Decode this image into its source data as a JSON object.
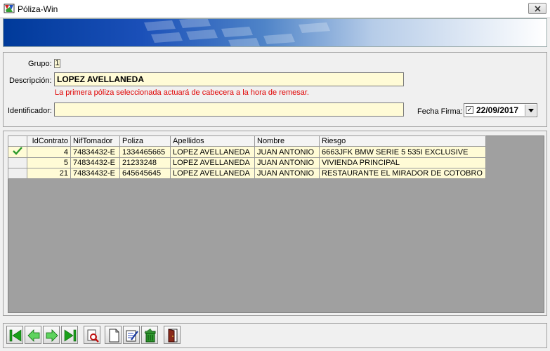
{
  "window": {
    "title": "Póliza-Win"
  },
  "form": {
    "grupo_label": "Grupo:",
    "grupo_value": "1",
    "descripcion_label": "Descripción:",
    "descripcion_value": "LOPEZ AVELLANEDA",
    "notice": "La primera póliza seleccionada actuará de cabecera a la hora de remesar.",
    "identificador_label": "Identificador:",
    "identificador_value": "",
    "fecha_firma_label": "Fecha Firma:",
    "fecha_firma_checked": true,
    "fecha_firma_value": "22/09/2017"
  },
  "grid": {
    "columns": [
      "IdContrato",
      "NifTomador",
      "Poliza",
      "Apellidos",
      "Nombre",
      "Riesgo"
    ],
    "rows": [
      {
        "selected": true,
        "IdContrato": "4",
        "NifTomador": "74834432-E",
        "Poliza": "1334465665",
        "Apellidos": "LOPEZ AVELLANEDA",
        "Nombre": "JUAN ANTONIO",
        "Riesgo": "6663JFK BMW SERIE 5 535I EXCLUSIVE"
      },
      {
        "selected": false,
        "IdContrato": "5",
        "NifTomador": "74834432-E",
        "Poliza": "21233248",
        "Apellidos": "LOPEZ AVELLANEDA",
        "Nombre": "JUAN ANTONIO",
        "Riesgo": "VIVIENDA PRINCIPAL"
      },
      {
        "selected": false,
        "IdContrato": "21",
        "NifTomador": "74834432-E",
        "Poliza": "645645645",
        "Apellidos": "LOPEZ AVELLANEDA",
        "Nombre": "JUAN ANTONIO",
        "Riesgo": "RESTAURANTE EL MIRADOR DE COTOBRO"
      }
    ]
  },
  "toolbar": {
    "buttons": [
      "first-record-icon",
      "previous-record-icon",
      "next-record-icon",
      "last-record-icon",
      "preview-icon",
      "new-document-icon",
      "edit-document-icon",
      "delete-icon",
      "exit-door-icon"
    ]
  },
  "colors": {
    "field_bg": "#fffbd6",
    "notice": "#e00000",
    "grid_bg": "#a0a0a0",
    "nav_green": "#1aa01a"
  }
}
